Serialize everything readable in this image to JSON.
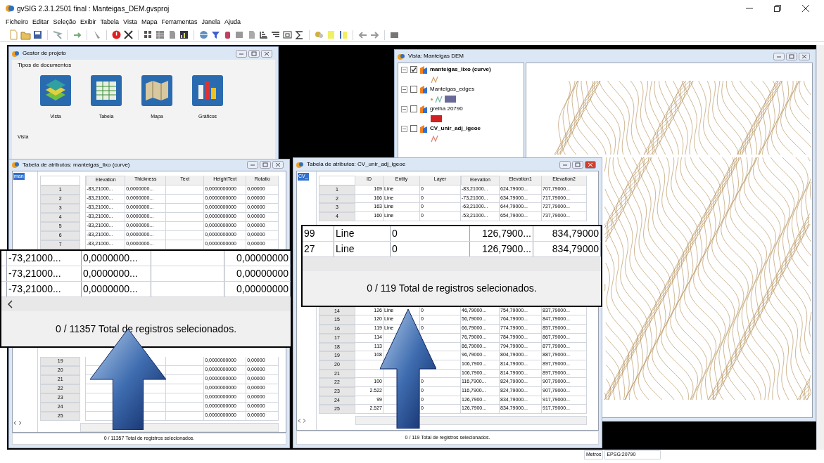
{
  "window": {
    "title": "gvSIG 2.3.1.2501 final : Manteigas_DEM.gvsproj"
  },
  "menu": [
    "Ficheiro",
    "Editar",
    "Seleção",
    "Exibir",
    "Tabela",
    "Vista",
    "Mapa",
    "Ferramentas",
    "Janela",
    "Ajuda"
  ],
  "project_manager": {
    "title": "Gestor de projeto",
    "section_label": "Tipos de documentos",
    "document_types": [
      {
        "kind": "view",
        "label": "Vista"
      },
      {
        "kind": "table",
        "label": "Tabela"
      },
      {
        "kind": "map",
        "label": "Mapa"
      },
      {
        "kind": "chart",
        "label": "Gráficos"
      }
    ],
    "list_label": "Vista"
  },
  "view": {
    "title": "Vista: Manteigas DEM",
    "layers": [
      {
        "name": "manteigas_lixo (curve)",
        "checked": true,
        "bold": true,
        "kind": "line",
        "color": "#d9a060"
      },
      {
        "name": "Manteigas_edges",
        "checked": false,
        "bold": false,
        "kind": "line_fill",
        "color": "#6a6a9a"
      },
      {
        "name": "grelha  20790",
        "checked": false,
        "bold": false,
        "kind": "fill",
        "color": "#d02020"
      },
      {
        "name": "CV_unir_adj_igeoe",
        "checked": false,
        "bold": true,
        "kind": "line",
        "color": "#e08070"
      }
    ]
  },
  "tables": [
    {
      "title": "Tabela de atributos: manteigas_lixo (curve)",
      "tab": "man",
      "columns": [
        "Elevation",
        "Thickness",
        "Text",
        "HeightText",
        "Rotatio"
      ],
      "rows_top": [
        {
          "number": "1",
          "cells": [
            "-83,21000...",
            "0,0000000...",
            null,
            "0,0000000000",
            "0,00000"
          ]
        },
        {
          "number": "2",
          "cells": [
            "-83,21000...",
            "0,0000000...",
            null,
            "0,0000000000",
            "0,00000"
          ]
        },
        {
          "number": "3",
          "cells": [
            "-83,21000...",
            "0,0000000...",
            null,
            "0,0000000000",
            "0,00000"
          ]
        },
        {
          "number": "4",
          "cells": [
            "-83,21000...",
            "0,0000000...",
            null,
            "0,0000000000",
            "0,00000"
          ]
        },
        {
          "number": "5",
          "cells": [
            "-83,21000...",
            "0,0000000...",
            null,
            "0,0000000000",
            "0,00000"
          ]
        },
        {
          "number": "6",
          "cells": [
            "-83,21000...",
            "0,0000000...",
            null,
            "0,0000000000",
            "0,00000"
          ]
        },
        {
          "number": "7",
          "cells": [
            "-83,21000...",
            "0,0000000...",
            null,
            "0,0000000000",
            "0,00000"
          ]
        }
      ],
      "rows_bottom": [
        {
          "number": "19",
          "cells": [
            null,
            null,
            null,
            "0,0000000000",
            "0,00000"
          ]
        },
        {
          "number": "20",
          "cells": [
            null,
            null,
            null,
            "0,0000000000",
            "0,00000"
          ]
        },
        {
          "number": "21",
          "cells": [
            null,
            null,
            null,
            "0,0000000000",
            "0,00000"
          ]
        },
        {
          "number": "22",
          "cells": [
            null,
            null,
            null,
            "0,0000000000",
            "0,00000"
          ]
        },
        {
          "number": "23",
          "cells": [
            null,
            null,
            null,
            "0,0000000000",
            "0,00000"
          ]
        },
        {
          "number": "24",
          "cells": [
            null,
            null,
            null,
            "0,0000000000",
            "0,00000"
          ]
        },
        {
          "number": "25",
          "cells": [
            null,
            null,
            null,
            "0,0000000000",
            "0,00000"
          ]
        }
      ],
      "status": "0 / 11357 Total de registros selecionados."
    },
    {
      "title": "Tabela de atributos: CV_unir_adj_igeoe",
      "tab": "CV_",
      "columns": [
        "ID",
        "Entity",
        "Layer",
        "Elevation",
        "Elevation1",
        "Elevation2"
      ],
      "rows_top": [
        {
          "number": "1",
          "cells": [
            "169",
            "Line",
            "0",
            "-83,21000...",
            "624,79000...",
            "707,79000..."
          ]
        },
        {
          "number": "2",
          "cells": [
            "166",
            "Line",
            "0",
            "-73,21000...",
            "634,79000...",
            "717,79000..."
          ]
        },
        {
          "number": "3",
          "cells": [
            "163",
            "Line",
            "0",
            "-63,21000...",
            "644,79000...",
            "727,79000..."
          ]
        },
        {
          "number": "4",
          "cells": [
            "160",
            "Line",
            "0",
            "-53,21000...",
            "654,79000...",
            "737,79000..."
          ]
        }
      ],
      "rows_bottom": [
        {
          "number": "14",
          "cells": [
            "126",
            "Line",
            "0",
            "46,79000...",
            "754,79000...",
            "837,79000..."
          ]
        },
        {
          "number": "15",
          "cells": [
            "120",
            "Line",
            "0",
            "56,79000...",
            "764,79000...",
            "847,79000..."
          ]
        },
        {
          "number": "16",
          "cells": [
            "119",
            "Line",
            "0",
            "66,79000...",
            "774,79000...",
            "857,79000..."
          ]
        },
        {
          "number": "17",
          "cells": [
            "114",
            null,
            null,
            "76,79000...",
            "784,79000...",
            "867,79000..."
          ]
        },
        {
          "number": "18",
          "cells": [
            "113",
            null,
            null,
            "86,79000...",
            "794,79000...",
            "877,79000..."
          ]
        },
        {
          "number": "19",
          "cells": [
            "108",
            null,
            null,
            "96,79000...",
            "804,79000...",
            "887,79000..."
          ]
        },
        {
          "number": "20",
          "cells": [
            null,
            null,
            null,
            "106,7900...",
            "814,79000...",
            "897,79000..."
          ]
        },
        {
          "number": "21",
          "cells": [
            null,
            null,
            null,
            "106,7900...",
            "814,79000...",
            "897,79000..."
          ]
        },
        {
          "number": "22",
          "cells": [
            "100",
            null,
            "0",
            "116,7900...",
            "824,79000...",
            "907,79000..."
          ]
        },
        {
          "number": "23",
          "cells": [
            "2.522",
            null,
            "0",
            "116,7900...",
            "824,79000...",
            "907,79000..."
          ]
        },
        {
          "number": "24",
          "cells": [
            "99",
            null,
            "0",
            "126,7900...",
            "834,79000...",
            "917,79000..."
          ]
        },
        {
          "number": "25",
          "cells": [
            "2.527",
            null,
            "0",
            "126,7900...",
            "834,79000...",
            "917,79000..."
          ]
        }
      ],
      "status": "0 / 119 Total de registros selecionados."
    }
  ],
  "callouts": [
    {
      "rows": [
        [
          "-73,21000...",
          "0,0000000...",
          null,
          "0,00000000"
        ],
        [
          "-73,21000...",
          "0,0000000...",
          null,
          "0,00000000"
        ],
        [
          "-73,21000...",
          "0,0000000...",
          null,
          "0,00000000"
        ]
      ],
      "status": "0 / 11357 Total de registros selecionados."
    },
    {
      "rows": [
        [
          "99",
          "Line",
          "0",
          "126,7900...",
          "834,79000"
        ],
        [
          "27",
          "Line",
          "0",
          "126,7900...",
          "834,79000"
        ]
      ],
      "status": "0 / 119 Total de registros selecionados."
    }
  ],
  "status_bar": {
    "units": "Metros",
    "crs": "EPSG:20790"
  }
}
